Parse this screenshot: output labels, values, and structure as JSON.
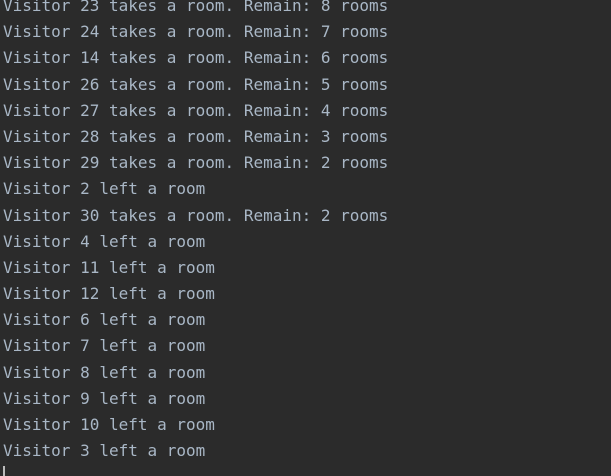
{
  "console": {
    "lines": [
      "Visitor 23 takes a room. Remain: 8 rooms",
      "Visitor 24 takes a room. Remain: 7 rooms",
      "Visitor 14 takes a room. Remain: 6 rooms",
      "Visitor 26 takes a room. Remain: 5 rooms",
      "Visitor 27 takes a room. Remain: 4 rooms",
      "Visitor 28 takes a room. Remain: 3 rooms",
      "Visitor 29 takes a room. Remain: 2 rooms",
      "Visitor 2 left a room",
      "Visitor 30 takes a room. Remain: 2 rooms",
      "Visitor 4 left a room",
      "Visitor 11 left a room",
      "Visitor 12 left a room",
      "Visitor 6 left a room",
      "Visitor 7 left a room",
      "Visitor 8 left a room",
      "Visitor 9 left a room",
      "Visitor 10 left a room",
      "Visitor 3 left a room"
    ]
  },
  "theme": {
    "background": "#2b2b2b",
    "text": "#a9b7c6",
    "caret": "#bbbbbb"
  }
}
